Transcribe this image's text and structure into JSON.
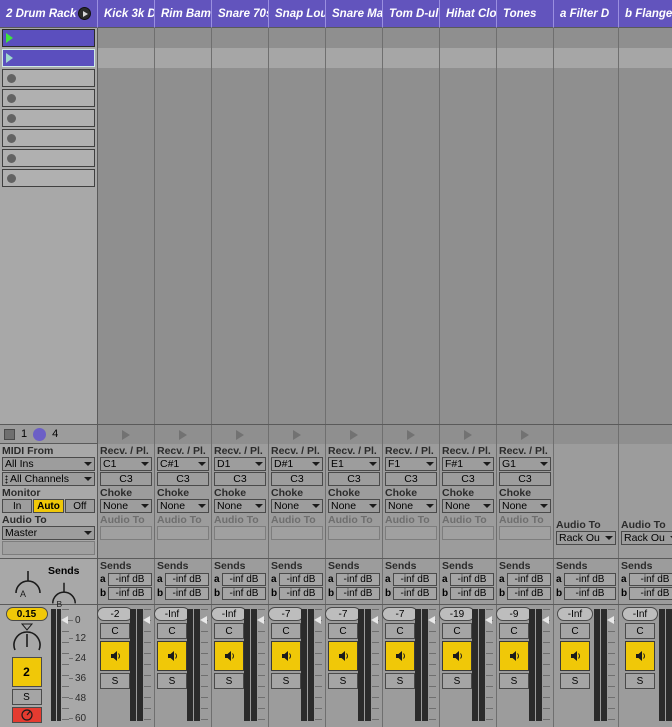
{
  "app": {
    "view": "Session View"
  },
  "master_track": {
    "name": "2 Drum Rack",
    "fold_icon": "play-circle-icon",
    "clips": [
      {
        "state": "playing",
        "play_icon": "play-triangle-icon"
      },
      {
        "state": "selected",
        "play_icon": "play-triangle-icon"
      },
      {
        "state": "empty",
        "stop_icon": "stop-dot-icon"
      },
      {
        "state": "empty",
        "stop_icon": "stop-dot-icon"
      },
      {
        "state": "empty",
        "stop_icon": "stop-dot-icon"
      },
      {
        "state": "empty",
        "stop_icon": "stop-dot-icon"
      },
      {
        "state": "empty",
        "stop_icon": "stop-dot-icon"
      },
      {
        "state": "empty",
        "stop_icon": "stop-dot-icon"
      }
    ],
    "scene_bar": {
      "stop_icon": "square-icon",
      "left_num": "1",
      "dot_icon": "scene-dot-icon",
      "right_num": "4"
    },
    "io": {
      "midi_from_label": "MIDI From",
      "midi_from_value": "All Ins",
      "midi_channel_value": "All Channels",
      "monitor_label": "Monitor",
      "monitor_options": [
        "In",
        "Auto",
        "Off"
      ],
      "monitor_selected": "Auto",
      "audio_to_label": "Audio To",
      "audio_to_value": "Master",
      "audio_sub_value": ""
    },
    "sends": {
      "label": "Sends",
      "knob_a": "A",
      "knob_b": "B"
    },
    "mixer": {
      "volume": "0.15",
      "pan_label": "",
      "btn_number": "2",
      "solo": "S",
      "record_icon": "record-arm-icon",
      "scale": [
        "0",
        "12",
        "24",
        "36",
        "48",
        "60"
      ]
    }
  },
  "tracks": [
    {
      "name": "Kick 3k D",
      "recv": "C1",
      "pitch": "C3",
      "choke": "None",
      "volume": "-2",
      "crossfade": "C",
      "solo": "S",
      "activator_icon": "speaker-icon"
    },
    {
      "name": "Rim Bam",
      "recv": "C#1",
      "pitch": "C3",
      "choke": "None",
      "volume": "-Inf",
      "crossfade": "C",
      "solo": "S",
      "activator_icon": "speaker-icon"
    },
    {
      "name": "Snare 70s",
      "recv": "D1",
      "pitch": "C3",
      "choke": "None",
      "volume": "-Inf",
      "crossfade": "C",
      "solo": "S",
      "activator_icon": "speaker-icon"
    },
    {
      "name": "Snap Lou",
      "recv": "D#1",
      "pitch": "C3",
      "choke": "None",
      "volume": "-7",
      "crossfade": "C",
      "solo": "S",
      "activator_icon": "speaker-icon"
    },
    {
      "name": "Snare Ma",
      "recv": "E1",
      "pitch": "C3",
      "choke": "None",
      "volume": "-7",
      "crossfade": "C",
      "solo": "S",
      "activator_icon": "speaker-icon"
    },
    {
      "name": "Tom D-ul",
      "recv": "F1",
      "pitch": "C3",
      "choke": "None",
      "volume": "-7",
      "crossfade": "C",
      "solo": "S",
      "activator_icon": "speaker-icon"
    },
    {
      "name": "Hihat Clo",
      "recv": "F#1",
      "pitch": "C3",
      "choke": "None",
      "volume": "-19",
      "crossfade": "C",
      "solo": "S",
      "activator_icon": "speaker-icon"
    },
    {
      "name": "Tones",
      "recv": "G1",
      "pitch": "C3",
      "choke": "None",
      "volume": "-9",
      "crossfade": "C",
      "solo": "S",
      "activator_icon": "speaker-icon"
    }
  ],
  "returns": [
    {
      "name": "a Filter D",
      "audio_to": "Rack Ou",
      "volume": "-Inf",
      "crossfade": "C",
      "solo": "S",
      "activator_icon": "speaker-icon"
    },
    {
      "name": "b Flanger",
      "audio_to": "Rack Ou",
      "volume": "-Inf",
      "crossfade": "C",
      "solo": "S",
      "activator_icon": "speaker-icon"
    }
  ],
  "labels": {
    "recv_pl": "Recv. / Pl.",
    "choke": "Choke",
    "audio_to": "Audio To",
    "sends": "Sends",
    "send_a": "a",
    "send_b": "b",
    "send_value": "-inf dB"
  },
  "colors": {
    "track_header": "#6254bd",
    "clip_active": "#5b4fbe",
    "accent_yellow": "#f0c808",
    "record_red": "#e53b30",
    "play_green": "#3ee23e",
    "panel_bg": "#9c9c9c",
    "master_bg": "#a8a8a8",
    "grid_bg": "#8f8f8f"
  }
}
